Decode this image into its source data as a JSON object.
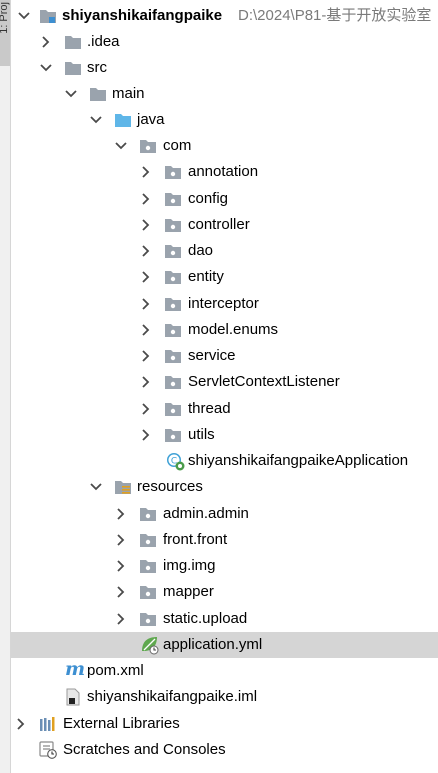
{
  "side_tab": {
    "label": "1: Proj"
  },
  "tree": {
    "root": {
      "name": "shiyanshikaifangpaike",
      "path": "D:\\2024\\P81-基于开放实验室"
    },
    "idea": ".idea",
    "src": "src",
    "main": "main",
    "java": "java",
    "com": "com",
    "packages": [
      "annotation",
      "config",
      "controller",
      "dao",
      "entity",
      "interceptor",
      "model.enums",
      "service",
      "ServletContextListener",
      "thread",
      "utils"
    ],
    "app_class": "shiyanshikaifangpaikeApplication",
    "resources": "resources",
    "resource_folders": [
      "admin.admin",
      "front.front",
      "img.img",
      "mapper",
      "static.upload"
    ],
    "application_yml": "application.yml",
    "pom": "pom.xml",
    "iml": "shiyanshikaifangpaike.iml",
    "external_libraries": "External Libraries",
    "scratches": "Scratches and Consoles"
  }
}
